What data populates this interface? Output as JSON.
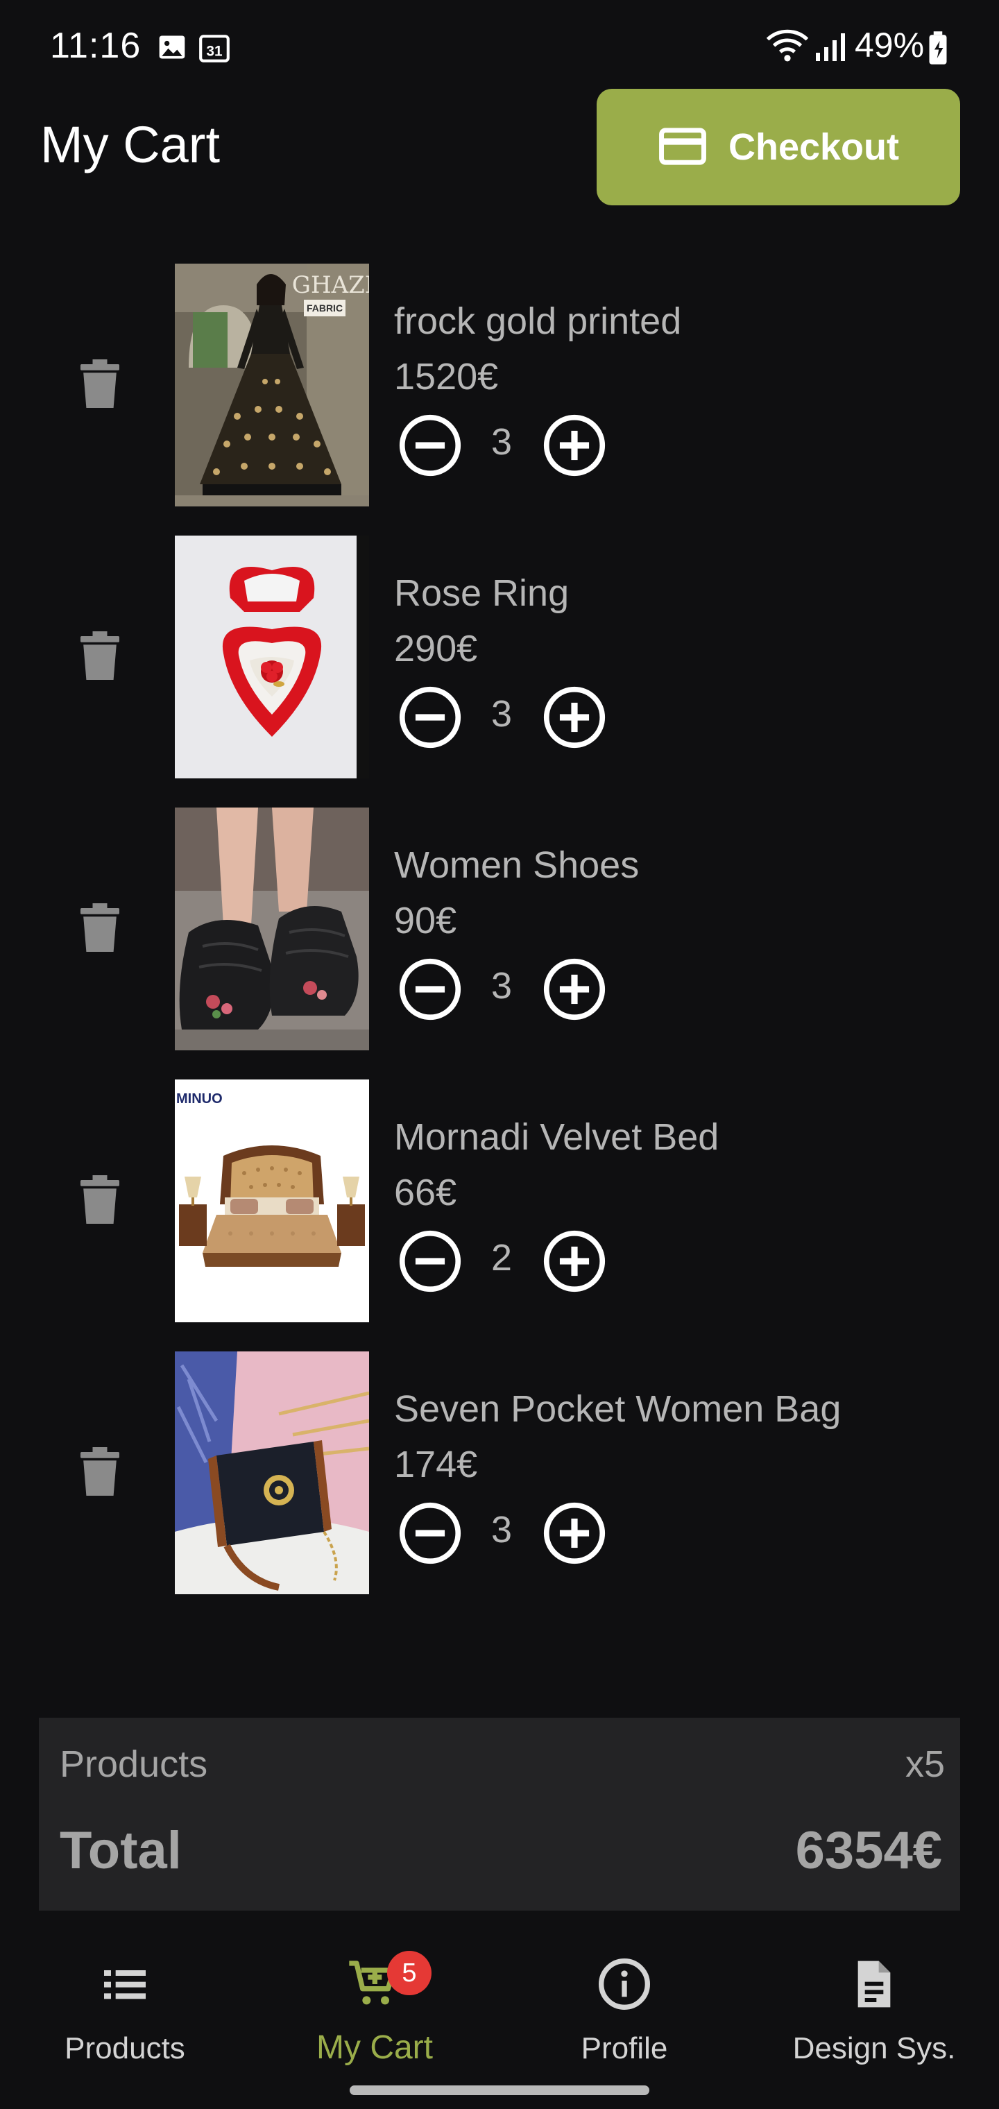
{
  "status_bar": {
    "time": "11:16",
    "calendar_day": "31",
    "battery": "49%"
  },
  "header": {
    "title": "My Cart",
    "checkout_label": "Checkout"
  },
  "cart": {
    "items": [
      {
        "name": "frock gold printed",
        "price": "1520€",
        "quantity": "3",
        "image": "dress-photo"
      },
      {
        "name": "Rose Ring",
        "price": "290€",
        "quantity": "3",
        "image": "ring-photo"
      },
      {
        "name": "Women Shoes",
        "price": "90€",
        "quantity": "3",
        "image": "shoes-photo"
      },
      {
        "name": "Mornadi Velvet Bed",
        "price": "66€",
        "quantity": "2",
        "image": "bed-photo"
      },
      {
        "name": "Seven Pocket Women Bag",
        "price": "174€",
        "quantity": "3",
        "image": "bag-photo"
      }
    ]
  },
  "summary": {
    "products_label": "Products",
    "products_count": "x5",
    "total_label": "Total",
    "total_value": "6354€"
  },
  "nav": {
    "items": [
      {
        "label": "Products",
        "icon": "list-icon"
      },
      {
        "label": "My Cart",
        "icon": "cart-icon",
        "badge": "5"
      },
      {
        "label": "Profile",
        "icon": "info-icon"
      },
      {
        "label": "Design Sys.",
        "icon": "document-icon"
      }
    ]
  },
  "colors": {
    "background": "#0f0f11",
    "accent": "#9aad4a",
    "summary_bg": "#232325",
    "badge": "#e53935",
    "muted_text": "#b6b6b6"
  }
}
